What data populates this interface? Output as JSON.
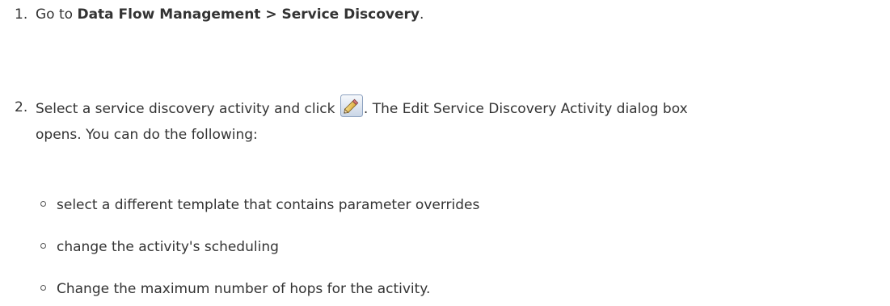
{
  "steps": [
    {
      "number": "1.",
      "prefix": "Go to ",
      "bold": "Data Flow Management > Service Discovery",
      "suffix": "."
    },
    {
      "number": "2.",
      "before_icon": "Select a service discovery activity and click ",
      "icon": "edit-pencil-icon",
      "after_icon_line1": ". The Edit Service Discovery Activity dialog box",
      "line2": "opens. You can do the following:"
    }
  ],
  "sub_items": [
    "select a different template that contains parameter overrides",
    "change the activity's scheduling",
    "Change the maximum number of hops for the activity."
  ]
}
